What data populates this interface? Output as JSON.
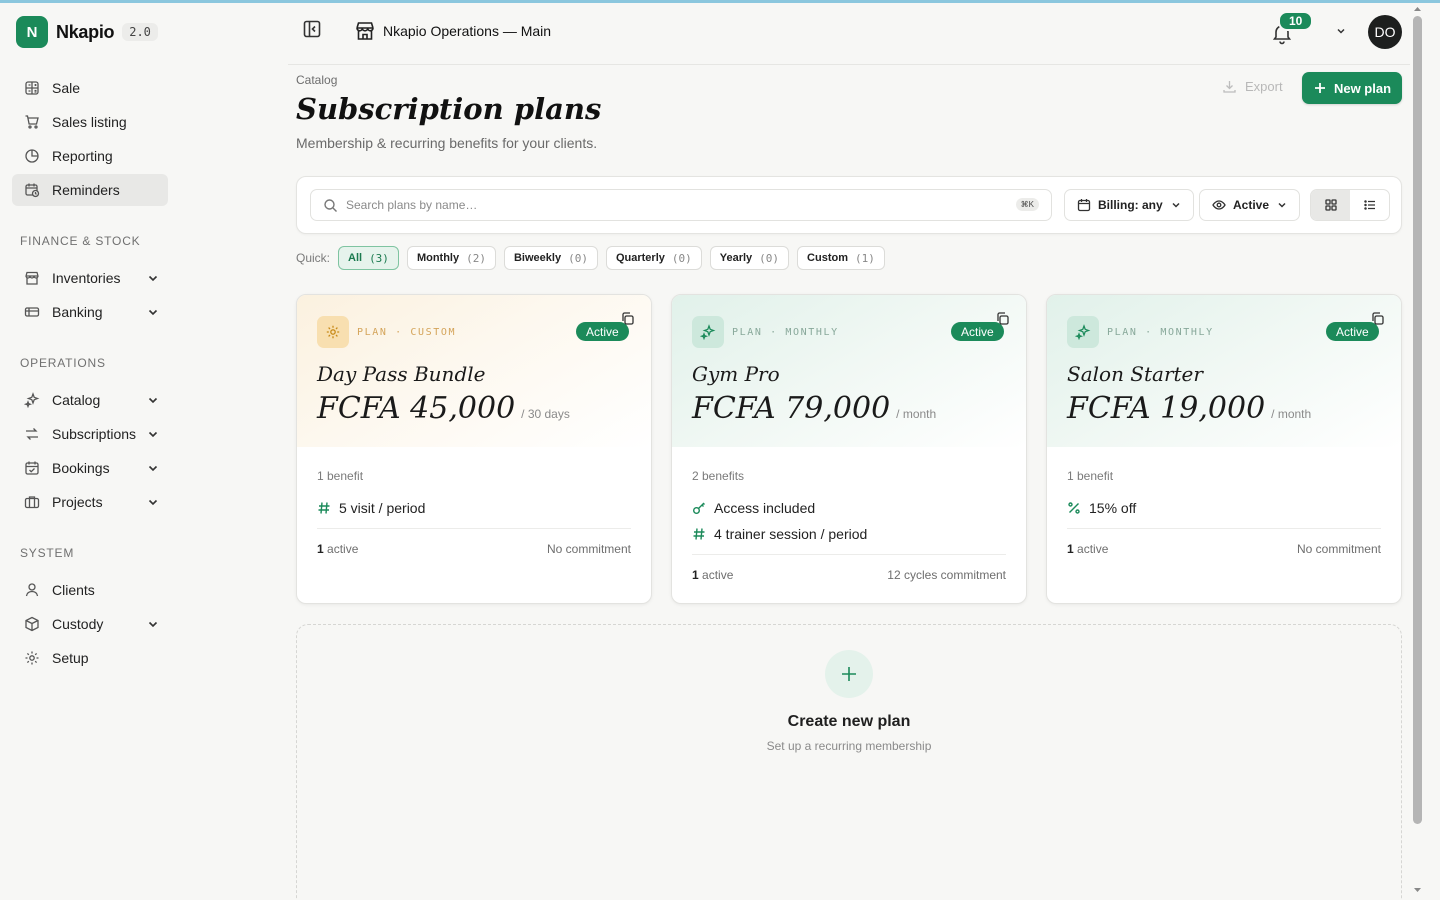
{
  "brand": {
    "logo_letter": "N",
    "name": "Nkapio",
    "version": "2.0"
  },
  "nav": {
    "main": [
      {
        "label": "Sale",
        "icon": "calculator-icon"
      },
      {
        "label": "Sales listing",
        "icon": "cart-icon"
      },
      {
        "label": "Reporting",
        "icon": "pie-chart-icon"
      },
      {
        "label": "Reminders",
        "icon": "calendar-clock-icon",
        "active": true
      }
    ],
    "finance_title": "FINANCE & STOCK",
    "finance": [
      {
        "label": "Inventories",
        "icon": "store-icon",
        "expandable": true
      },
      {
        "label": "Banking",
        "icon": "card-icon",
        "expandable": true
      }
    ],
    "operations_title": "OPERATIONS",
    "operations": [
      {
        "label": "Catalog",
        "icon": "sparkles-icon",
        "expandable": true
      },
      {
        "label": "Subscriptions",
        "icon": "repeat-icon",
        "expandable": true
      },
      {
        "label": "Bookings",
        "icon": "calendar-check-icon",
        "expandable": true
      },
      {
        "label": "Projects",
        "icon": "briefcase-icon",
        "expandable": true
      }
    ],
    "system_title": "SYSTEM",
    "system": [
      {
        "label": "Clients",
        "icon": "user-icon"
      },
      {
        "label": "Custody",
        "icon": "box-icon",
        "expandable": true
      },
      {
        "label": "Setup",
        "icon": "gear-icon"
      }
    ]
  },
  "header": {
    "workspace": "Nkapio Operations — Main",
    "notifications": "10",
    "avatar_initials": "DO"
  },
  "page": {
    "breadcrumb": "Catalog",
    "title": "Subscription plans",
    "subtitle": "Membership & recurring benefits for your clients.",
    "export_label": "Export",
    "new_label": "New plan"
  },
  "filters": {
    "search_placeholder": "Search plans by name…",
    "shortcut": "⌘K",
    "billing_label": "Billing: any",
    "status_label": "Active"
  },
  "quick": {
    "label": "Quick:",
    "chips": [
      {
        "label": "All",
        "count": "(3)",
        "active": true
      },
      {
        "label": "Monthly",
        "count": "(2)"
      },
      {
        "label": "Biweekly",
        "count": "(0)"
      },
      {
        "label": "Quarterly",
        "count": "(0)"
      },
      {
        "label": "Yearly",
        "count": "(0)"
      },
      {
        "label": "Custom",
        "count": "(1)"
      }
    ]
  },
  "plans": [
    {
      "kind": "PLAN · CUSTOM",
      "status": "Active",
      "name": "Day Pass Bundle",
      "price": "FCFA 45,000",
      "period": "/ 30 days",
      "benefit_count": "1 benefit",
      "benefits": [
        {
          "icon": "hash-icon",
          "text": "5 visit / period"
        }
      ],
      "active_count": "1",
      "active_label": "active",
      "commitment": "No commitment"
    },
    {
      "kind": "PLAN · MONTHLY",
      "status": "Active",
      "name": "Gym Pro",
      "price": "FCFA 79,000",
      "period": "/ month",
      "benefit_count": "2 benefits",
      "benefits": [
        {
          "icon": "key-icon",
          "text": "Access included"
        },
        {
          "icon": "hash-icon",
          "text": "4 trainer session / period"
        }
      ],
      "active_count": "1",
      "active_label": "active",
      "commitment": "12 cycles commitment"
    },
    {
      "kind": "PLAN · MONTHLY",
      "status": "Active",
      "name": "Salon Starter",
      "price": "FCFA 19,000",
      "period": "/ month",
      "benefit_count": "1 benefit",
      "benefits": [
        {
          "icon": "percent-icon",
          "text": "15% off"
        }
      ],
      "active_count": "1",
      "active_label": "active",
      "commitment": "No commitment"
    }
  ],
  "create": {
    "title": "Create new plan",
    "subtitle": "Set up a recurring membership"
  },
  "colors": {
    "accent": "#1b8a5a",
    "accent_soft": "#e6f3ec",
    "custom_tint": "#fbf1df"
  }
}
